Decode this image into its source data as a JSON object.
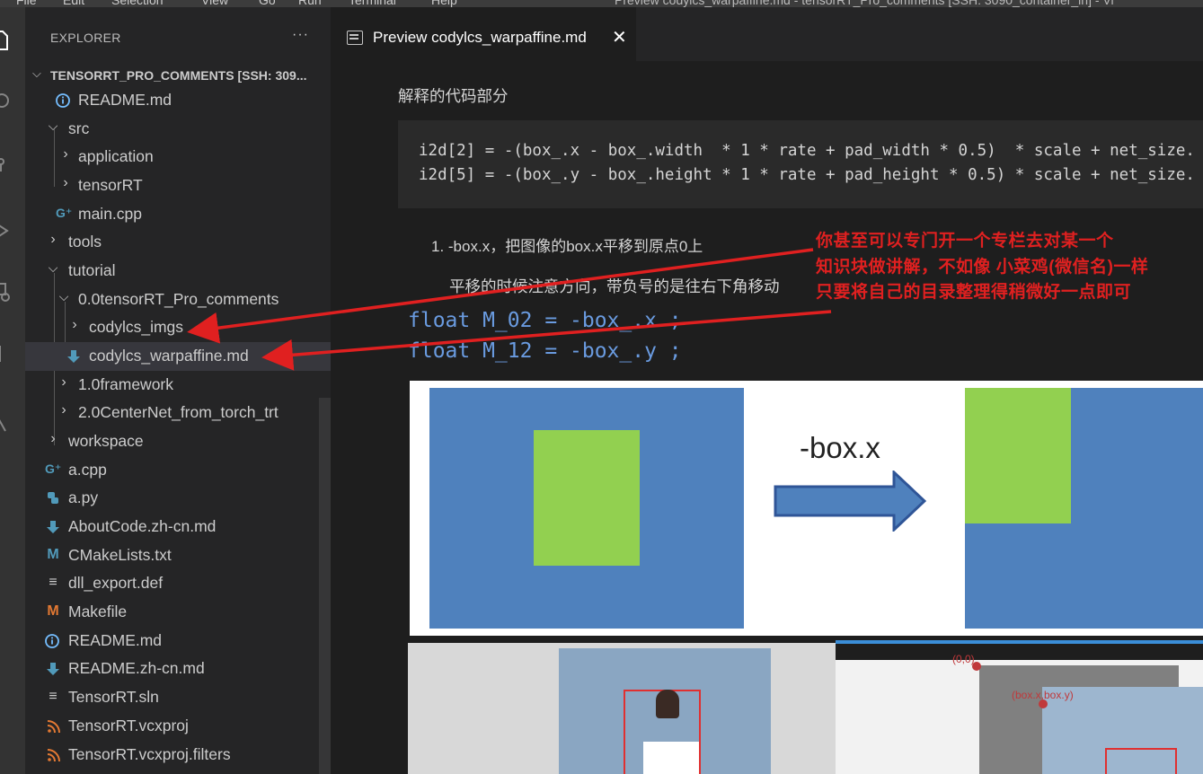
{
  "menubar": {
    "items": [
      "File",
      "Edit",
      "Selection",
      "View",
      "Go",
      "Run",
      "Terminal",
      "Help"
    ],
    "window_title": "Preview codylcs_warpaffine.md - tensorRT_Pro_comments [SSH: 3090_container_in] - Vi"
  },
  "sidebar": {
    "header": "EXPLORER",
    "more_label": "···",
    "root_label": "TENSORRT_PRO_COMMENTS [SSH: 309...",
    "items": [
      {
        "label": "README.md",
        "icon": "info-icon"
      },
      {
        "label": "src",
        "icon": "chevron-down-icon"
      },
      {
        "label": "application",
        "icon": "chevron-right-icon"
      },
      {
        "label": "tensorRT",
        "icon": "chevron-right-icon"
      },
      {
        "label": "main.cpp",
        "icon": "cpp-file-icon"
      },
      {
        "label": "tools",
        "icon": "chevron-right-icon"
      },
      {
        "label": "tutorial",
        "icon": "chevron-down-icon"
      },
      {
        "label": "0.0tensorRT_Pro_comments",
        "icon": "chevron-down-icon"
      },
      {
        "label": "codylcs_imgs",
        "icon": "chevron-right-icon"
      },
      {
        "label": "codylcs_warpaffine.md",
        "icon": "markdown-download-icon"
      },
      {
        "label": "1.0framework",
        "icon": "chevron-right-icon"
      },
      {
        "label": "2.0CenterNet_from_torch_trt",
        "icon": "chevron-right-icon"
      },
      {
        "label": "workspace",
        "icon": "chevron-right-icon"
      },
      {
        "label": "a.cpp",
        "icon": "cpp-file-icon"
      },
      {
        "label": "a.py",
        "icon": "python-file-icon"
      },
      {
        "label": "AboutCode.zh-cn.md",
        "icon": "markdown-download-icon"
      },
      {
        "label": "CMakeLists.txt",
        "icon": "cmake-icon"
      },
      {
        "label": "dll_export.def",
        "icon": "text-lines-icon"
      },
      {
        "label": "Makefile",
        "icon": "makefile-icon"
      },
      {
        "label": "README.md",
        "icon": "info-icon"
      },
      {
        "label": "README.zh-cn.md",
        "icon": "markdown-download-icon"
      },
      {
        "label": "TensorRT.sln",
        "icon": "text-lines-icon"
      },
      {
        "label": "TensorRT.vcxproj",
        "icon": "rss-icon"
      },
      {
        "label": "TensorRT.vcxproj.filters",
        "icon": "rss-icon"
      }
    ]
  },
  "tab": {
    "label": "Preview codylcs_warpaffine.md",
    "close": "✕"
  },
  "preview": {
    "heading": "解释的代码部分",
    "code_lines": [
      "i2d[2] = -(box_.x - box_.width  * 1 * rate + pad_width * 0.5)  * scale + net_size.",
      "i2d[5] = -(box_.y - box_.height * 1 * rate + pad_height * 0.5) * scale + net_size."
    ],
    "list_item": "1. -box.x，把图像的box.x平移到原点0上",
    "paragraph": "平移的时候注意方向，带负号的是往右下角移动",
    "float_lines": [
      "float M_02 = -box_.x ;",
      "float M_12 = -box_.y ;"
    ],
    "diagram_label": "-box.x",
    "photo2_labels": [
      "(0,0)",
      "(box.x,box.y)"
    ]
  },
  "annotation": {
    "lines": [
      "你甚至可以专门开一个专栏去对某一个",
      "知识块做讲解，不如像 小菜鸡(微信名)一样",
      "只要将自己的目录整理得稍微好一点即可"
    ],
    "color": "#e02020"
  }
}
